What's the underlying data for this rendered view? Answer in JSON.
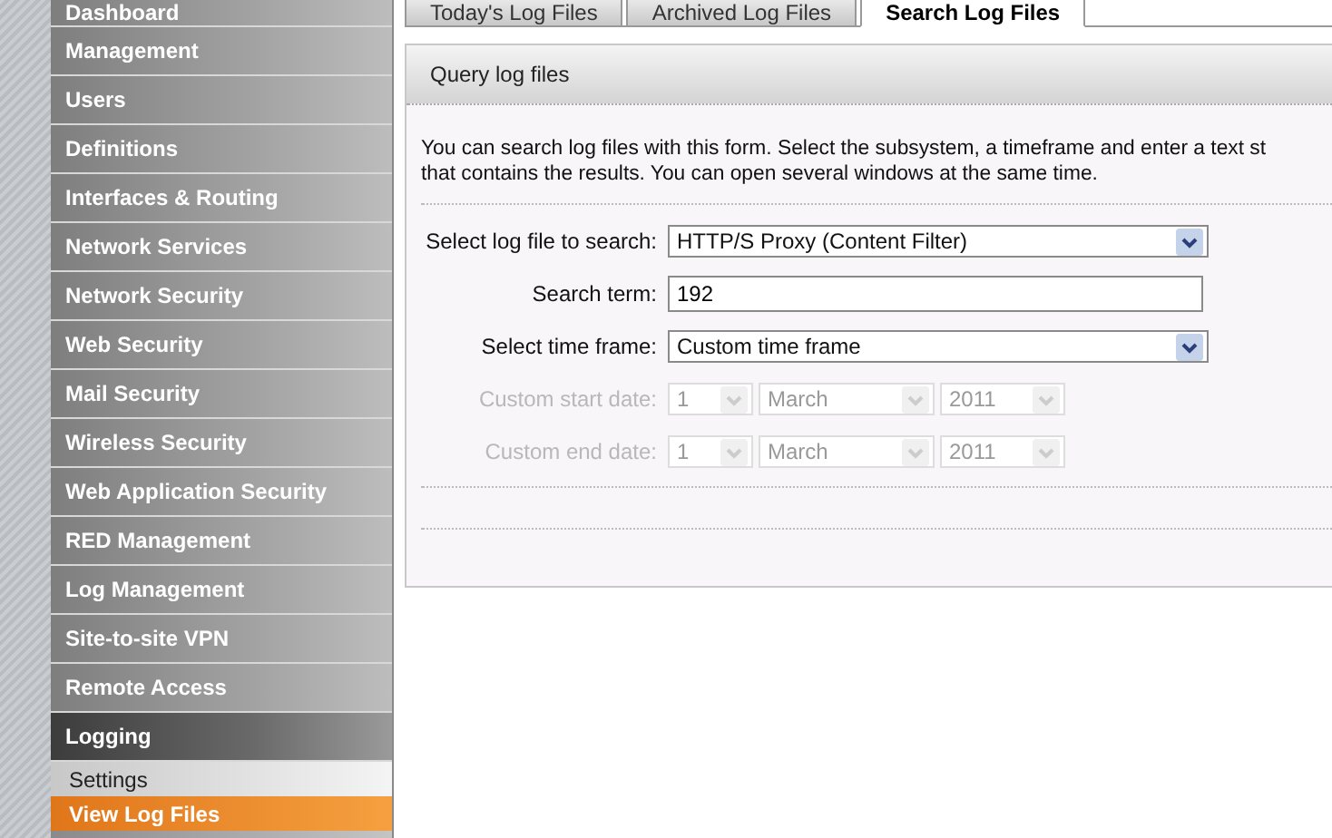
{
  "sidebar": {
    "items": [
      {
        "label": "Dashboard",
        "selected": false
      },
      {
        "label": "Management",
        "selected": false
      },
      {
        "label": "Users",
        "selected": false
      },
      {
        "label": "Definitions",
        "selected": false
      },
      {
        "label": "Interfaces & Routing",
        "selected": false
      },
      {
        "label": "Network Services",
        "selected": false
      },
      {
        "label": "Network Security",
        "selected": false
      },
      {
        "label": "Web Security",
        "selected": false
      },
      {
        "label": "Mail Security",
        "selected": false
      },
      {
        "label": "Wireless Security",
        "selected": false
      },
      {
        "label": "Web Application Security",
        "selected": false
      },
      {
        "label": "RED Management",
        "selected": false
      },
      {
        "label": "Log Management",
        "selected": false
      },
      {
        "label": "Site-to-site VPN",
        "selected": false
      },
      {
        "label": "Remote Access",
        "selected": false
      },
      {
        "label": "Logging",
        "selected": true,
        "children": [
          {
            "label": "Settings",
            "selected": false
          },
          {
            "label": "View Log Files",
            "selected": true
          }
        ]
      }
    ]
  },
  "tabs": [
    {
      "label": "Today's Log Files",
      "selected": false
    },
    {
      "label": "Archived Log Files",
      "selected": false
    },
    {
      "label": "Search Log Files",
      "selected": true
    }
  ],
  "panel": {
    "title": "Query log files",
    "description": [
      "You can search log files with this form. Select the subsystem, a timeframe and enter a text st",
      "that contains the results. You can open several windows at the same time."
    ],
    "fields": [
      {
        "kind": "select",
        "label": "Select log file to search:",
        "value": "HTTP/S Proxy (Content Filter)",
        "disabled": false
      },
      {
        "kind": "text",
        "label": "Search term:",
        "value": "192",
        "disabled": false
      },
      {
        "kind": "select",
        "label": "Select time frame:",
        "value": "Custom time frame",
        "disabled": false
      },
      {
        "kind": "date",
        "label": "Custom start date:",
        "day": "1",
        "month": "March",
        "year": "2011",
        "disabled": true
      },
      {
        "kind": "date",
        "label": "Custom end date:",
        "day": "1",
        "month": "March",
        "year": "2011",
        "disabled": true
      }
    ]
  }
}
